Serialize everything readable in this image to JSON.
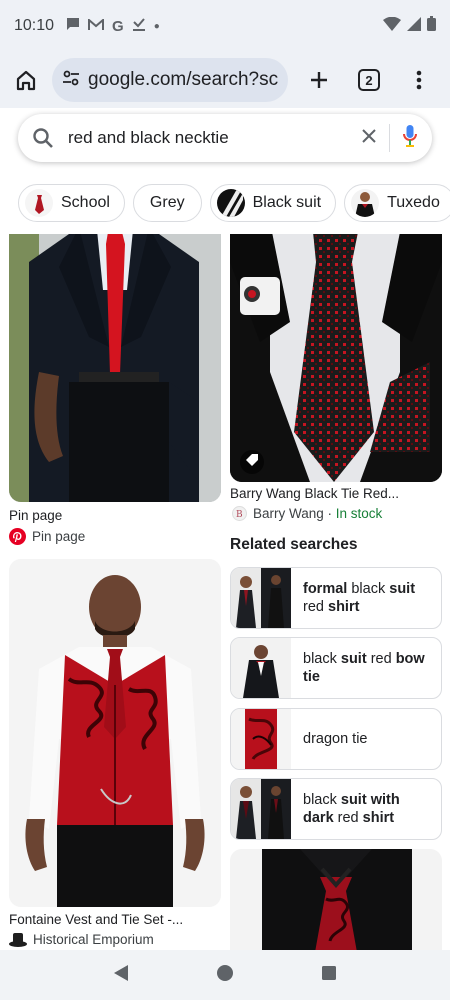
{
  "status_bar": {
    "time": "10:10"
  },
  "browser": {
    "url": "google.com/search?sca_",
    "tab_count": "2"
  },
  "search": {
    "query": "red and black necktie"
  },
  "chips": [
    {
      "label": "School"
    },
    {
      "label": "Grey"
    },
    {
      "label": "Black suit"
    },
    {
      "label": "Tuxedo"
    }
  ],
  "results": {
    "left_1": {
      "title": "Pin page",
      "source": "Pin page"
    },
    "right_1": {
      "title": "Barry Wang Black Tie Red...",
      "source": "Barry Wang",
      "separator": " · ",
      "status": "In stock"
    },
    "left_2": {
      "title": "Fontaine Vest and Tie Set -...",
      "source": "Historical Emporium"
    }
  },
  "related": {
    "title": "Related searches",
    "items": [
      {
        "parts": [
          [
            "formal",
            true
          ],
          [
            " black ",
            false
          ],
          [
            "suit",
            true
          ],
          [
            " red ",
            false
          ],
          [
            "shirt",
            true
          ]
        ],
        "text": "formal black suit red shirt"
      },
      {
        "parts": [
          [
            "black ",
            false
          ],
          [
            "suit",
            true
          ],
          [
            " red ",
            false
          ],
          [
            "bow tie",
            true
          ]
        ],
        "text": "black suit red bow tie"
      },
      {
        "parts": [
          [
            "dragon tie",
            false
          ]
        ],
        "text": "dragon tie"
      },
      {
        "parts": [
          [
            "black ",
            false
          ],
          [
            "suit with dark",
            true
          ],
          [
            " red ",
            false
          ],
          [
            "shirt",
            true
          ]
        ],
        "text": "black suit with dark red shirt"
      }
    ]
  },
  "colors": {
    "accent_blue": "#1a73e8",
    "in_stock_green": "#188038",
    "pinterest_red": "#e60023"
  }
}
